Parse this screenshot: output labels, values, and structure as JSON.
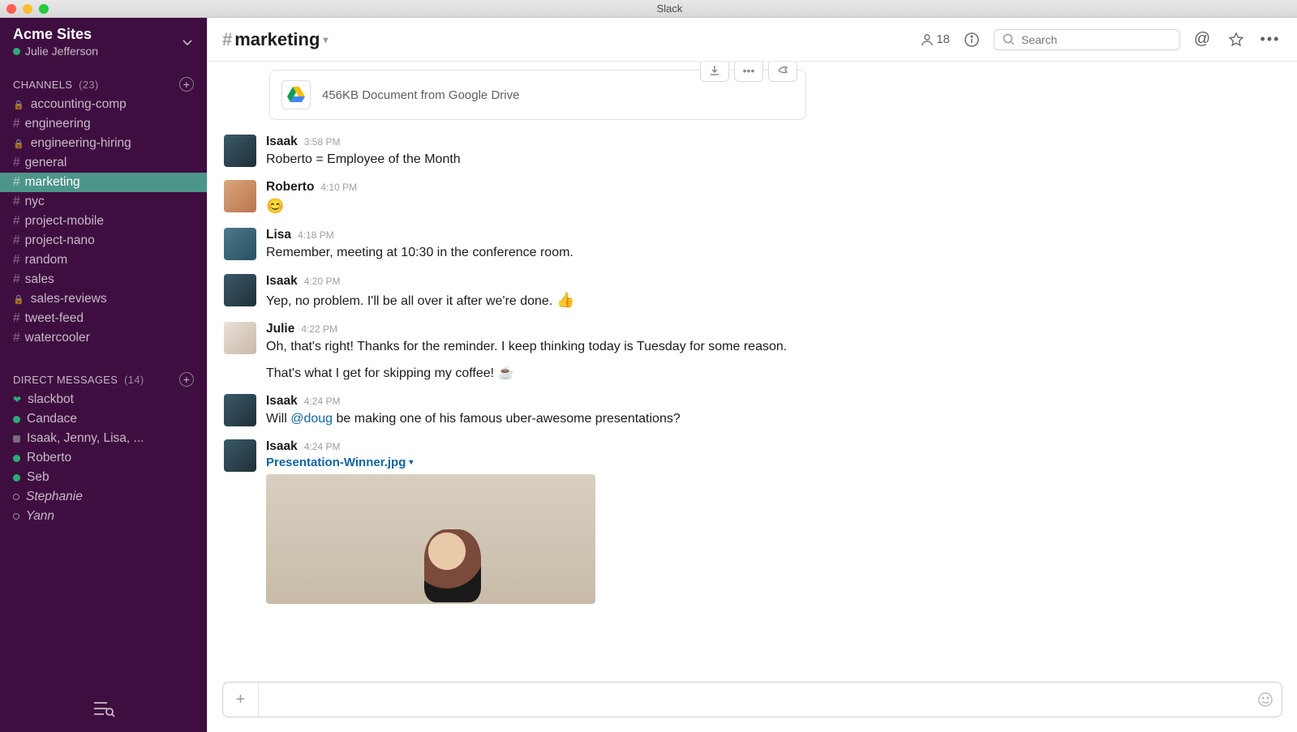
{
  "window": {
    "title": "Slack"
  },
  "team": {
    "name": "Acme Sites",
    "user": "Julie Jefferson"
  },
  "sidebar": {
    "channels_label": "Channels",
    "channels_count": "(23)",
    "dms_label": "Direct Messages",
    "dms_count": "(14)",
    "channels": [
      {
        "name": "accounting-comp",
        "locked": true
      },
      {
        "name": "engineering"
      },
      {
        "name": "engineering-hiring",
        "locked": true
      },
      {
        "name": "general"
      },
      {
        "name": "marketing",
        "active": true
      },
      {
        "name": "nyc"
      },
      {
        "name": "project-mobile"
      },
      {
        "name": "project-nano"
      },
      {
        "name": "random"
      },
      {
        "name": "sales"
      },
      {
        "name": "sales-reviews",
        "locked": true
      },
      {
        "name": "tweet-feed"
      },
      {
        "name": "watercooler"
      }
    ],
    "dms": [
      {
        "name": "slackbot",
        "icon": "heart"
      },
      {
        "name": "Candace",
        "presence": "active"
      },
      {
        "name": "Isaak, Jenny, Lisa, ...",
        "icon": "square"
      },
      {
        "name": "Roberto",
        "presence": "active"
      },
      {
        "name": "Seb",
        "presence": "active"
      },
      {
        "name": "Stephanie",
        "presence": "away",
        "italic": true
      },
      {
        "name": "Yann",
        "presence": "away",
        "italic": true
      }
    ]
  },
  "header": {
    "channel": "marketing",
    "members": "18",
    "search_placeholder": "Search"
  },
  "file": {
    "meta": "456KB Document from Google Drive"
  },
  "messages": [
    {
      "author": "Isaak",
      "time": "3:58 PM",
      "avatar": "isaak",
      "text": "Roberto = Employee of the Month"
    },
    {
      "author": "Roberto",
      "time": "4:10 PM",
      "avatar": "roberto",
      "emoji": "😊"
    },
    {
      "author": "Lisa",
      "time": "4:18 PM",
      "avatar": "lisa",
      "text": "Remember, meeting at 10:30 in the conference room."
    },
    {
      "author": "Isaak",
      "time": "4:20 PM",
      "avatar": "isaak",
      "text": "Yep, no problem. I'll be all over it after we're done.",
      "emoji_after": "👍"
    },
    {
      "author": "Julie",
      "time": "4:22 PM",
      "avatar": "julie",
      "text": "Oh, that's right! Thanks for the reminder. I keep thinking today is Tuesday for some reason.",
      "text2": "That's what I get for skipping my coffee! ☕"
    },
    {
      "author": "Isaak",
      "time": "4:24 PM",
      "avatar": "isaak",
      "text_pre": "Will ",
      "mention": "@doug",
      "text_post": " be making one of his famous uber-awesome presentations?"
    },
    {
      "author": "Isaak",
      "time": "4:24 PM",
      "avatar": "isaak",
      "file": "Presentation-Winner.jpg"
    }
  ]
}
